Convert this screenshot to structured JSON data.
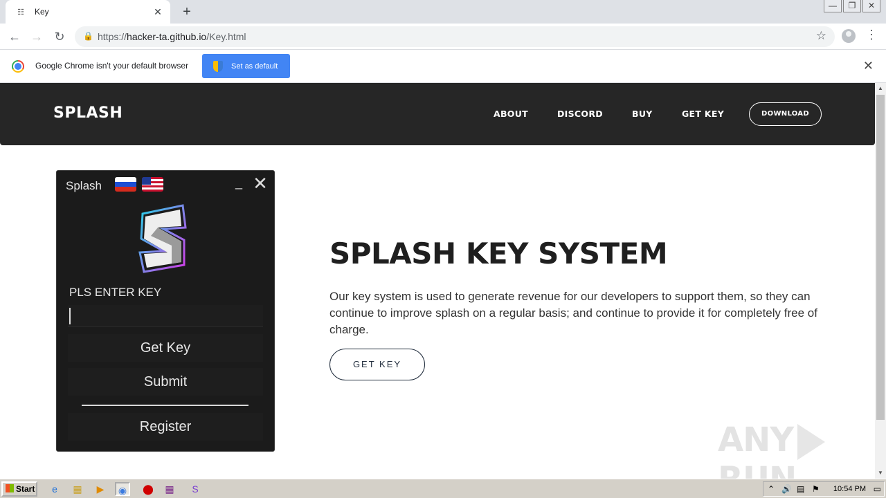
{
  "browser": {
    "tab_title": "Key",
    "url_scheme": "https://",
    "url_host": "hacker-ta.github.io",
    "url_path": "/Key.html"
  },
  "infobar": {
    "message": "Google Chrome isn't your default browser",
    "button_label": "Set as default"
  },
  "site": {
    "brand": "SPLASH",
    "nav": [
      "ABOUT",
      "DISCORD",
      "BUY",
      "GET KEY"
    ],
    "download_label": "DOWNLOAD"
  },
  "app": {
    "title": "Splash",
    "key_label": "PLS ENTER KEY",
    "get_key_label": "Get Key",
    "submit_label": "Submit",
    "register_label": "Register"
  },
  "hero": {
    "title": "SPLASH KEY SYSTEM",
    "description": "Our key system is used to generate revenue for our developers to support them, so they can continue to improve splash on a regular basis; and continue to provide it for completely free of charge.",
    "button_label": "GET KEY"
  },
  "watermark": {
    "left": "ANY",
    "right": "RUN"
  },
  "taskbar": {
    "start_label": "Start",
    "clock": "10:54 PM"
  }
}
